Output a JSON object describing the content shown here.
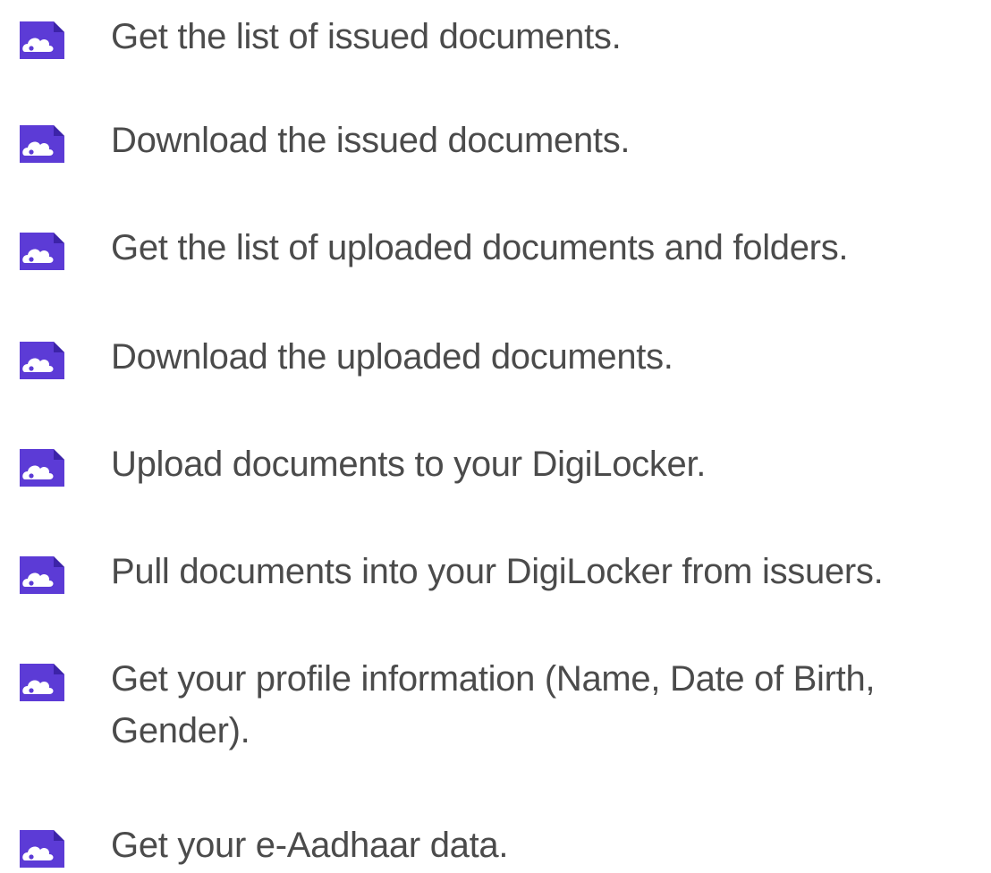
{
  "permissions": {
    "items": [
      {
        "icon": "cloud-document-icon",
        "label": "Get the list of issued documents."
      },
      {
        "icon": "cloud-document-icon",
        "label": "Download the issued documents."
      },
      {
        "icon": "cloud-document-icon",
        "label": "Get the list of uploaded documents and folders."
      },
      {
        "icon": "cloud-document-icon",
        "label": "Download the uploaded documents."
      },
      {
        "icon": "cloud-document-icon",
        "label": "Upload documents to your DigiLocker."
      },
      {
        "icon": "cloud-document-icon",
        "label": "Pull documents into your DigiLocker from issuers."
      },
      {
        "icon": "cloud-document-icon",
        "label": "Get your profile information (Name, Date of Birth, Gender)."
      },
      {
        "icon": "cloud-document-icon",
        "label": "Get your e-Aadhaar data."
      }
    ]
  },
  "colors": {
    "icon_primary": "#5c3bd6",
    "icon_light": "#7a5ff0",
    "text": "#4b4b4b",
    "background": "#ffffff"
  }
}
